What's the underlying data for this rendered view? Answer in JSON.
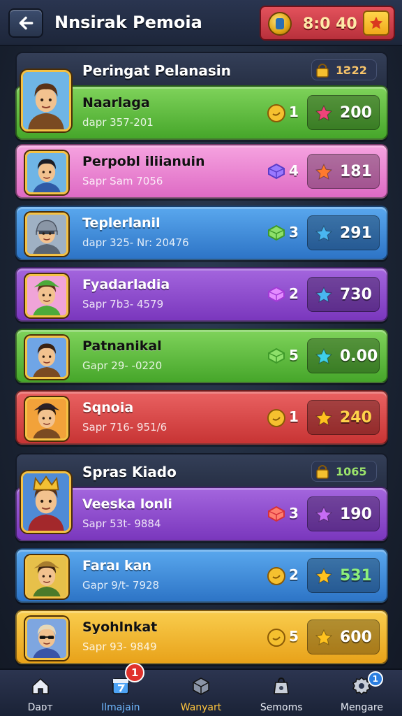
{
  "header": {
    "title": "Nnsirak Pemoia",
    "currency_value": "8:0 40"
  },
  "colors": {
    "green": "#5cb83a",
    "pink": "#ec7fcf",
    "blue": "#3b8ad9",
    "purple": "#8b45c9",
    "red": "#d94444",
    "yellow": "#f0b22c"
  },
  "sections": [
    {
      "title": "Peringat Pelanasin",
      "badge": "1Ƨ22",
      "badge_color": "#f7c46a",
      "players": [
        {
          "name": "Naarlaga",
          "sub": "dapr 357-201",
          "gem": "coin",
          "count": "1",
          "star": "pink",
          "score": "200",
          "color": "green",
          "avatar": "hero-brown"
        },
        {
          "name": "Perpobl iliianuin",
          "sub": "Sapr Sam 7056",
          "gem": "purple",
          "count": "4",
          "star": "orange",
          "score": "181",
          "color": "pink",
          "avatar": "hero-dark"
        },
        {
          "name": "Teplerlanil",
          "sub": "dapr 325- Nr: 20476",
          "gem": "green",
          "count": "3",
          "star": "blue",
          "score": "291",
          "color": "blue",
          "avatar": "knight"
        },
        {
          "name": "Fyadarladia",
          "sub": "Sapr 7b3- 4579",
          "gem": "violet",
          "count": "2",
          "star": "blue",
          "score": "730",
          "color": "purple",
          "avatar": "hero-green"
        },
        {
          "name": "Patnanikal",
          "sub": "Gapr 29- -0220",
          "gem": "green",
          "count": "5",
          "star": "cyan",
          "score": "0.00",
          "color": "green",
          "avatar": "hero-brown2"
        },
        {
          "name": "Sqnoia",
          "sub": "Sapr 716- 951/6",
          "gem": "coin",
          "count": "1",
          "star": "gold",
          "score": "240",
          "color": "red",
          "avatar": "hero-hat"
        }
      ]
    },
    {
      "title": "Spras Kiado",
      "badge": "1065",
      "badge_color": "#9be36b",
      "players": [
        {
          "name": "Veeska lonli",
          "sub": "Sapr 53t- 9884",
          "gem": "red",
          "count": "3",
          "star": "violet",
          "score": "190",
          "color": "purple",
          "avatar": "king"
        },
        {
          "name": "Faraı kan",
          "sub": "Gapr 9/t- 7928",
          "gem": "coin",
          "count": "2",
          "star": "gold",
          "score": "531",
          "color": "blue",
          "avatar": "hero-yellow"
        },
        {
          "name": "Syohlnkat",
          "sub": "Sapr 93- 9849",
          "gem": "coin",
          "count": "5",
          "star": "gold",
          "score": "600",
          "color": "yellow",
          "avatar": "hero-shades"
        }
      ]
    }
  ],
  "nav": [
    {
      "label": "Daᴅᴛ",
      "icon": "home-icon",
      "state": "normal",
      "badge": ""
    },
    {
      "label": "Ilmajain",
      "icon": "calendar-icon",
      "state": "active",
      "badge": "1"
    },
    {
      "label": "Wanyart",
      "icon": "box-icon",
      "state": "highlight",
      "badge": ""
    },
    {
      "label": "Semoms",
      "icon": "bag-icon",
      "state": "normal",
      "badge": ""
    },
    {
      "label": "Mengare",
      "icon": "gear-icon",
      "state": "normal",
      "badge": "1"
    }
  ]
}
